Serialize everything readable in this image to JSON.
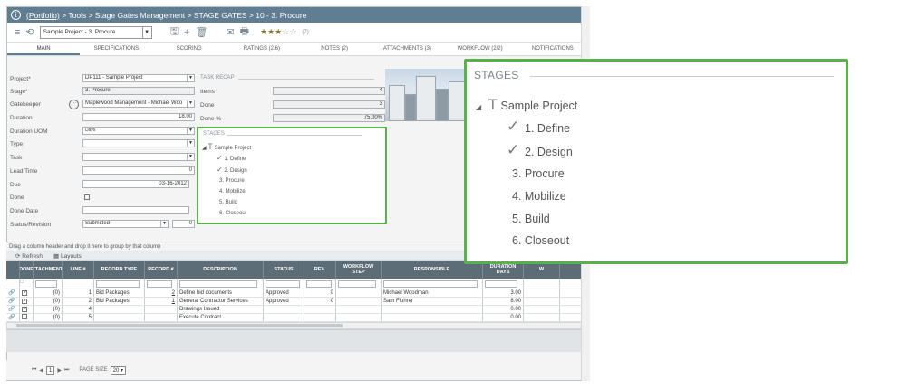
{
  "header": {
    "info_icon": "i",
    "portfolio_link": "(Portfolio)",
    "breadcrumb": " > Tools > Stage Gates Management > STAGE GATES > 10 - 3. Procure"
  },
  "toolbar": {
    "record_select": "Sample Project - 3. Procure",
    "rating_count": "(7)"
  },
  "tabs": [
    "MAIN",
    "SPECIFICATIONS",
    "SCORING",
    "RATINGS (2.6)",
    "NOTES (2)",
    "ATTACHMENTS (3)",
    "WORKFLOW (2/2)",
    "NOTIFICATIONS"
  ],
  "form": {
    "project_label": "Project*",
    "project_value": "DP111 - Sample Project",
    "stage_label": "Stage*",
    "stage_value": "3. Procure",
    "gatekeeper_label": "Gatekeeper",
    "gatekeeper_value": "Maplewood Management - Michael Woo",
    "duration_label": "Duration",
    "duration_value": "18.00",
    "duration_uom_label": "Duration UOM",
    "duration_uom_value": "Days",
    "type_label": "Type",
    "task_label": "Task",
    "lead_time_label": "Lead Time",
    "lead_time_value": "0",
    "due_label": "Due",
    "due_value": "03-16-2012",
    "done_label": "Done",
    "done_date_label": "Done Date",
    "status_label": "Status/Revision",
    "status_value": "Submitted",
    "revision_value": "0"
  },
  "task_recap": {
    "title": "TASK RECAP",
    "items_label": "Items",
    "items_value": "4",
    "done_label": "Done",
    "done_value": "3",
    "done_pct_label": "Done %",
    "done_pct_value": "75.00%"
  },
  "stages": {
    "title": "STAGES",
    "root": "Sample Project",
    "items": [
      "1. Define",
      "2. Design",
      "3. Procure",
      "4. Mobilize",
      "5. Build",
      "6. Closeout"
    ],
    "completed": [
      true,
      true,
      false,
      false,
      false,
      false
    ]
  },
  "grid": {
    "group_hint": "Drag a column header and drop it here to group by that column",
    "refresh_label": "Refresh",
    "layouts_label": "Layouts",
    "columns": [
      "DONE",
      "ATTACHMENTS",
      "LINE #",
      "RECORD TYPE",
      "RECORD #",
      "DESCRIPTION",
      "STATUS",
      "REV.",
      "WORKFLOW STEP",
      "RESPONSIBLE",
      "DURATION DAYS",
      "W"
    ],
    "rows": [
      {
        "done": true,
        "attach": "(0)",
        "line": "1",
        "rtype": "Bid Packages",
        "rnum": "2",
        "desc": "Define bid documents",
        "status": "Approved",
        "rev": "0",
        "resp": "Michael Woodman",
        "dur": "3.00"
      },
      {
        "done": true,
        "attach": "(0)",
        "line": "2",
        "rtype": "Bid Packages",
        "rnum": "1",
        "desc": "General Contractor Services",
        "status": "Approved",
        "rev": "0",
        "resp": "Sam Fluhrer",
        "dur": "8.00"
      },
      {
        "done": true,
        "attach": "(0)",
        "line": "4",
        "rtype": "",
        "rnum": "",
        "desc": "Drawings Issued",
        "status": "",
        "rev": "",
        "resp": "",
        "dur": "0.00"
      },
      {
        "done": false,
        "attach": "(0)",
        "line": "5",
        "rtype": "",
        "rnum": "",
        "desc": "Execute Contract",
        "status": "",
        "rev": "",
        "resp": "",
        "dur": "0.00"
      }
    ]
  },
  "pager": {
    "page": "1",
    "page_size_label": "PAGE SIZE",
    "page_size": "20"
  },
  "callout": {
    "title": "STAGES",
    "root": "Sample Project",
    "items": [
      "1. Define",
      "2. Design",
      "3. Procure",
      "4. Mobilize",
      "5. Build",
      "6. Closeout"
    ]
  },
  "colors": {
    "topbar": "#607d92",
    "highlight": "#5ab04a",
    "grid_header": "#5d6d78"
  }
}
